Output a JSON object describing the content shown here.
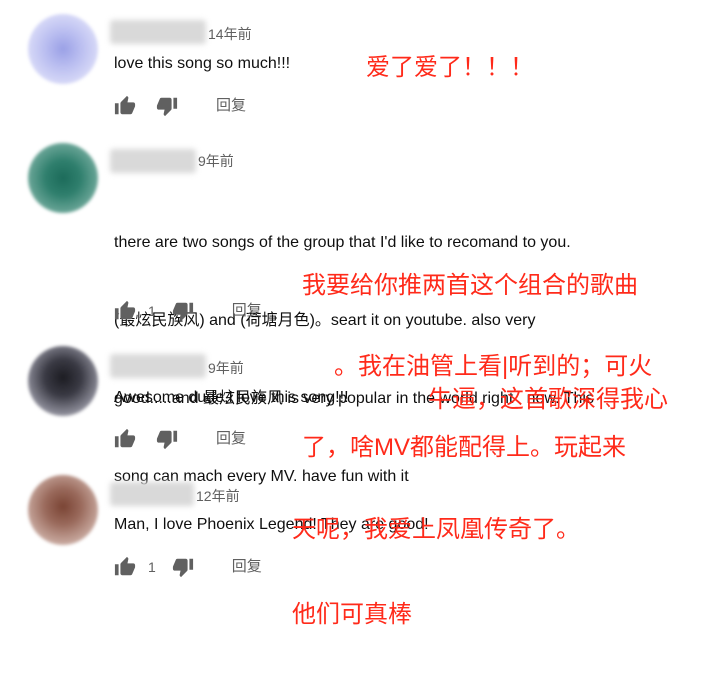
{
  "comments": [
    {
      "time": "14年前",
      "text": "love this song so much!!!",
      "likes": "",
      "reply_label": "回复",
      "note": "爱了爱了！！！"
    },
    {
      "time": "9年前",
      "text_lines": [
        "there are two songs of the group that I'd like to recomand to you.",
        "(最炫民族风) and (荷塘月色)。seart it on youtube. also very",
        "good.....and 最炫民族风 is very popular in the world right   now. This",
        "song can mach every MV. have fun with it"
      ],
      "likes": "1",
      "reply_label": "回复",
      "note_lines": [
        "我要给你推两首这个组合的歌曲",
        "。我在油管上看|听到的；可火",
        "了，啥MV都能配得上。玩起来"
      ]
    },
    {
      "time": "9年前",
      "text": "Awesome dude,I love this song!!!",
      "likes": "",
      "reply_label": "回复",
      "note": "牛逼，这首歌深得我心"
    },
    {
      "time": "12年前",
      "text": "Man, I love Phoenix Legend! They are good!",
      "likes": "1",
      "reply_label": "回复",
      "note_lines": [
        "天呢，我爱上凤凰传奇了。",
        "他们可真棒"
      ]
    }
  ],
  "colors": {
    "annotation": "#ff2a1a",
    "meta": "#606060",
    "text": "#0f0f0f"
  },
  "icons": {
    "like": "thumbs-up-icon",
    "dislike": "thumbs-down-icon"
  }
}
